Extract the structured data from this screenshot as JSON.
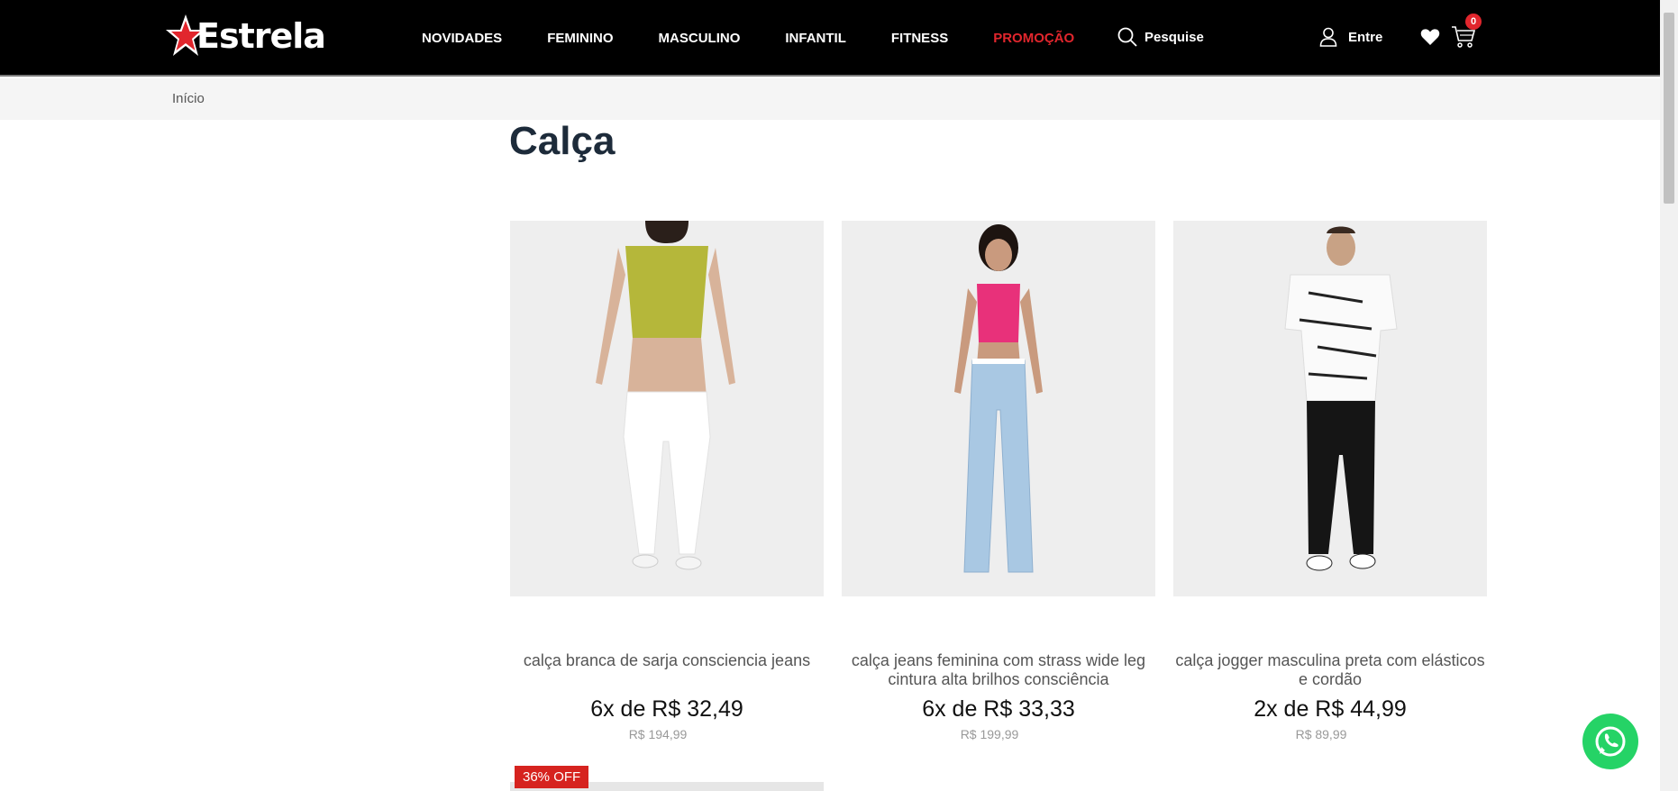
{
  "header": {
    "logo_text": "Estrela",
    "nav": [
      {
        "label": "NOVIDADES"
      },
      {
        "label": "FEMININO"
      },
      {
        "label": "MASCULINO"
      },
      {
        "label": "INFANTIL"
      },
      {
        "label": "FITNESS"
      },
      {
        "label": "PROMOÇÃO"
      }
    ],
    "search_label": "Pesquise",
    "account_label": "Entre",
    "cart_count": "0"
  },
  "breadcrumb": "Início",
  "page_title": "Calça",
  "products": [
    {
      "name": "calça branca de sarja consciencia jeans",
      "price": "6x de R$ 32,49",
      "old_price": "R$ 194,99"
    },
    {
      "name": "calça jeans feminina com strass wide leg cintura alta brilhos consciência",
      "price": "6x de R$ 33,33",
      "old_price": "R$ 199,99"
    },
    {
      "name": "calça jogger masculina preta com elásticos e cordão",
      "price": "2x de R$ 44,99",
      "old_price": "R$ 89,99"
    }
  ],
  "next_product_badge": "36% OFF",
  "icons": {
    "search": "search-icon",
    "account": "user-icon",
    "wishlist": "heart-icon",
    "cart": "cart-icon",
    "chat": "whatsapp-icon"
  },
  "colors": {
    "header_bg": "#000000",
    "promo": "#e1262d",
    "badge": "#d6231f",
    "whatsapp": "#25d366"
  }
}
